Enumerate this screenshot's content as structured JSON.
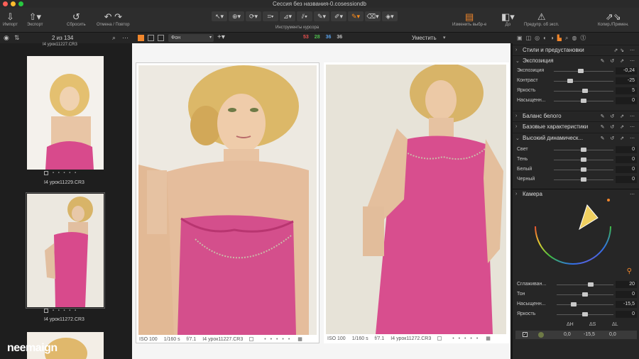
{
  "window": {
    "title": "Сессия без названия-0.cosessiondb"
  },
  "toolbar": {
    "import": "Импорт",
    "export": "Экспорт",
    "reset": "Сбросить",
    "undo_redo": "Отмена / Повтор",
    "cursor_tools": "Инструменты курсора",
    "change_selection": "Изменить выбр-е",
    "before": "До",
    "exposure_warning": "Предупр. об эксп.",
    "copy_apply": "Копир./Примен."
  },
  "browser": {
    "count": "2 из 134"
  },
  "viewer_bar": {
    "background_option": "Фон",
    "stats": [
      "53",
      "28",
      "36",
      "36"
    ],
    "fit_label": "Уместить"
  },
  "filmstrip": {
    "top_label": "I4 урок11227.CR3",
    "thumbs": [
      {
        "label": "I4 урок11229.CR3"
      },
      {
        "label": "I4 урок11272.CR3"
      }
    ],
    "watermark": "neemaign"
  },
  "viewer": {
    "photo1": {
      "iso": "ISO 100",
      "shutter": "1/160 s",
      "aperture": "f/7.1",
      "name": "I4 урок11227.CR3"
    },
    "photo2": {
      "iso": "ISO 100",
      "shutter": "1/160 s",
      "aperture": "f/7.1",
      "name": "I4 урок11272.CR3"
    }
  },
  "panel": {
    "styles_title": "Стили и предустановки",
    "exposure_title": "Экспозиция",
    "exposure_sliders": [
      {
        "label": "Экспозиция",
        "value": "-0,24",
        "pos": 0.45
      },
      {
        "label": "Контраст",
        "value": "-25",
        "pos": 0.27
      },
      {
        "label": "Яркость",
        "value": "5",
        "pos": 0.52
      },
      {
        "label": "Насыщенн...",
        "value": "0",
        "pos": 0.5
      }
    ],
    "wb_title": "Баланс белого",
    "basic_title": "Базовые характеристики",
    "hdr_title": "Высокий динамическ...",
    "hdr_sliders": [
      {
        "label": "Свет",
        "value": "0",
        "pos": 0.5
      },
      {
        "label": "Тень",
        "value": "0",
        "pos": 0.5
      },
      {
        "label": "Белый",
        "value": "0",
        "pos": 0.5
      },
      {
        "label": "Черный",
        "value": "0",
        "pos": 0.5
      }
    ],
    "camera_title": "Камера",
    "color_sliders": [
      {
        "label": "Сглаживан...",
        "value": "20",
        "pos": 0.6
      },
      {
        "label": "Тон",
        "value": "0",
        "pos": 0.5
      },
      {
        "label": "Насыщенн...",
        "value": "-15,5",
        "pos": 0.3
      },
      {
        "label": "Яркость",
        "value": "0",
        "pos": 0.5
      }
    ],
    "color_table": {
      "headers": [
        "ΔH",
        "ΔS",
        "ΔL"
      ],
      "row": [
        "0,0",
        "-15,5",
        "0,0"
      ],
      "swatch_color": "#6e7a46"
    }
  },
  "colors": {
    "accent": "#f0862c",
    "stat_red": "#e8504e",
    "stat_green": "#4ec04e",
    "stat_blue": "#5aa0e8",
    "stat_gray": "#c0c0c0"
  }
}
